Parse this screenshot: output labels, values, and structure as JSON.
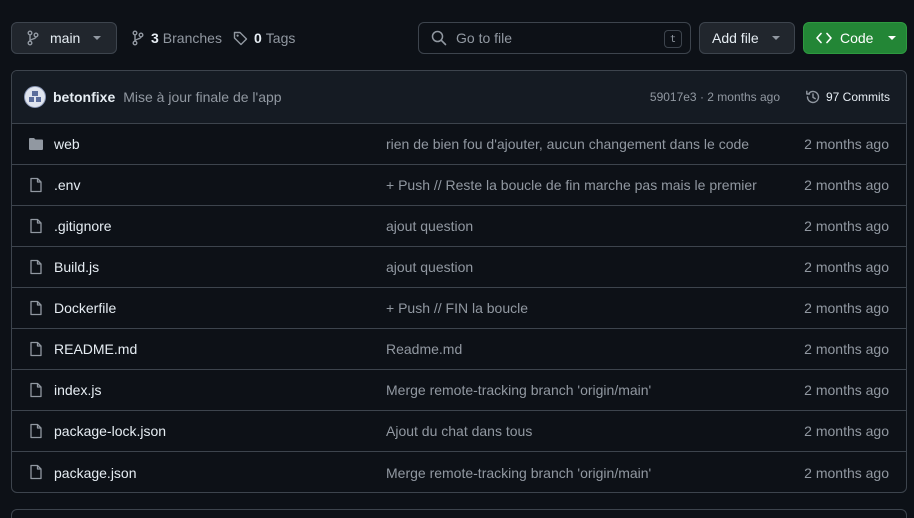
{
  "toolbar": {
    "branch": "main",
    "branches_count": "3",
    "branches_label": "Branches",
    "tags_count": "0",
    "tags_label": "Tags",
    "search_placeholder": "Go to file",
    "search_shortcut": "t",
    "add_file_label": "Add file",
    "code_label": "Code"
  },
  "latest_commit": {
    "author": "betonfixe",
    "message": "Mise à jour finale de l'app",
    "hash_time": "59017e3 · 2 months ago",
    "commits_label": "97 Commits"
  },
  "files": [
    {
      "name": "web",
      "type": "folder",
      "message": "rien de bien fou d'ajouter, aucun changement dans le code",
      "time": "2 months ago"
    },
    {
      "name": ".env",
      "type": "file",
      "message": "+ Push // Reste la boucle de fin marche pas mais le premier",
      "time": "2 months ago"
    },
    {
      "name": ".gitignore",
      "type": "file",
      "message": "ajout question",
      "time": "2 months ago"
    },
    {
      "name": "Build.js",
      "type": "file",
      "message": "ajout question",
      "time": "2 months ago"
    },
    {
      "name": "Dockerfile",
      "type": "file",
      "message": "+ Push // FIN la boucle",
      "time": "2 months ago"
    },
    {
      "name": "README.md",
      "type": "file",
      "message": "Readme.md",
      "time": "2 months ago"
    },
    {
      "name": "index.js",
      "type": "file",
      "message": "Merge remote-tracking branch 'origin/main'",
      "time": "2 months ago"
    },
    {
      "name": "package-lock.json",
      "type": "file",
      "message": "Ajout du chat dans tous",
      "time": "2 months ago"
    },
    {
      "name": "package.json",
      "type": "file",
      "message": "Merge remote-tracking branch 'origin/main'",
      "time": "2 months ago"
    }
  ],
  "colors": {
    "background": "#0d1117",
    "border": "#3d444d",
    "muted_text": "#9198a1",
    "code_button": "#238636"
  }
}
